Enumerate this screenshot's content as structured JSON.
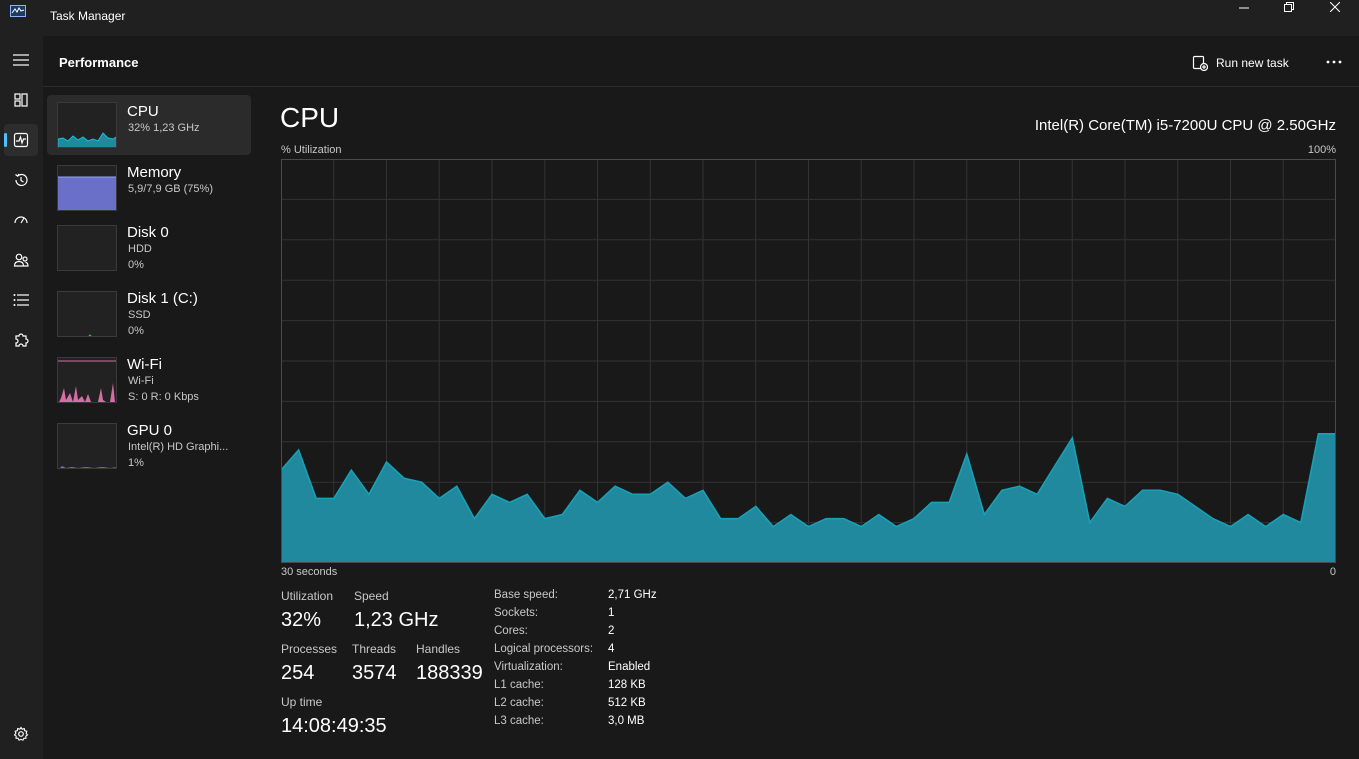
{
  "window": {
    "title": "Task Manager"
  },
  "header": {
    "page_title": "Performance",
    "run_task_label": "Run new task"
  },
  "nav": {
    "items": [
      "processes",
      "performance",
      "app-history",
      "startup-apps",
      "users",
      "details",
      "services",
      "settings"
    ],
    "active": "performance"
  },
  "devices": [
    {
      "name": "CPU",
      "sub1": "32%  1,23 GHz",
      "sub2": ""
    },
    {
      "name": "Memory",
      "sub1": "5,9/7,9 GB (75%)",
      "sub2": ""
    },
    {
      "name": "Disk 0",
      "sub1": "HDD",
      "sub2": "0%"
    },
    {
      "name": "Disk 1 (C:)",
      "sub1": "SSD",
      "sub2": "0%"
    },
    {
      "name": "Wi-Fi",
      "sub1": "Wi-Fi",
      "sub2": "S: 0 R: 0 Kbps"
    },
    {
      "name": "GPU 0",
      "sub1": "Intel(R) HD Graphi...",
      "sub2": "1%"
    }
  ],
  "cpu_panel": {
    "title": "CPU",
    "model": "Intel(R) Core(TM) i5-7200U CPU @ 2.50GHz",
    "y_label": "% Utilization",
    "y_max_label": "100%",
    "x_left_label": "30 seconds",
    "x_right_label": "0"
  },
  "stats": {
    "utilization_label": "Utilization",
    "utilization": "32%",
    "speed_label": "Speed",
    "speed": "1,23 GHz",
    "processes_label": "Processes",
    "processes": "254",
    "threads_label": "Threads",
    "threads": "3574",
    "handles_label": "Handles",
    "handles": "188339",
    "uptime_label": "Up time",
    "uptime": "14:08:49:35"
  },
  "specs": [
    {
      "key": "Base speed:",
      "value": "2,71 GHz"
    },
    {
      "key": "Sockets:",
      "value": "1"
    },
    {
      "key": "Cores:",
      "value": "2"
    },
    {
      "key": "Logical processors:",
      "value": "4"
    },
    {
      "key": "Virtualization:",
      "value": "Enabled"
    },
    {
      "key": "L1 cache:",
      "value": "128 KB"
    },
    {
      "key": "L2 cache:",
      "value": "512 KB"
    },
    {
      "key": "L3 cache:",
      "value": "3,0 MB"
    }
  ],
  "colors": {
    "cpu_line": "#17a2b8",
    "cpu_fill": "#21899e",
    "memory_fill": "#6a6fc8",
    "wifi_fill": "#d46fa6",
    "accent": "#4cc2ff"
  },
  "chart_data": {
    "type": "area",
    "ylim": [
      0,
      100
    ],
    "x": [
      30,
      29.5,
      29,
      28.5,
      28,
      27.5,
      27,
      26.5,
      26,
      25.5,
      25,
      24.5,
      24,
      23.5,
      23,
      22.5,
      22,
      21.5,
      21,
      20.5,
      20,
      19.5,
      19,
      18.5,
      18,
      17.5,
      17,
      16.5,
      16,
      15.5,
      15,
      14.5,
      14,
      13.5,
      13,
      12.5,
      12,
      11.5,
      11,
      10.5,
      10,
      9.5,
      9,
      8.5,
      8,
      7.5,
      7,
      6.5,
      6,
      5.5,
      5,
      4.5,
      4,
      3.5,
      3,
      2.5,
      2,
      1.5,
      1,
      0.5,
      0
    ],
    "values": [
      23,
      28,
      16,
      16,
      23,
      17,
      25,
      21,
      20,
      16,
      19,
      11,
      17,
      15,
      17,
      11,
      12,
      18,
      15,
      19,
      17,
      17,
      20,
      16,
      18,
      11,
      11,
      14,
      9,
      12,
      9,
      11,
      11,
      9,
      12,
      9,
      11,
      15,
      15,
      27,
      12,
      18,
      19,
      17,
      24,
      31,
      10,
      16,
      14,
      18,
      18,
      17,
      14,
      11,
      9,
      12,
      9,
      12,
      10,
      32,
      32
    ]
  }
}
